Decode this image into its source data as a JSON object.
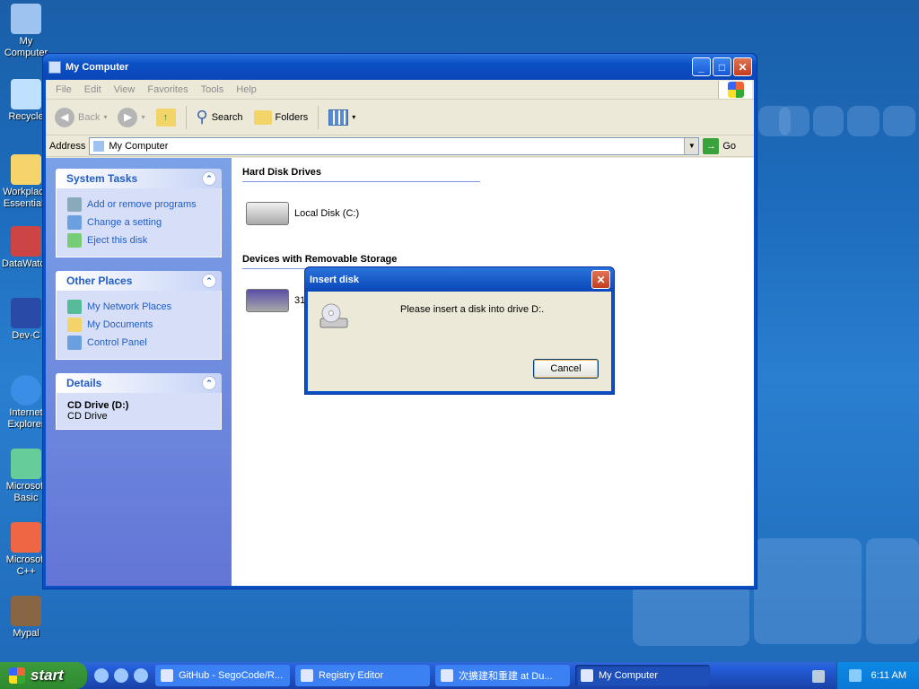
{
  "desktop": {
    "icons": [
      {
        "label": "My Computer"
      },
      {
        "label": "Recycle"
      },
      {
        "label": "Workplace Essentials"
      },
      {
        "label": "DataWatch"
      },
      {
        "label": "Dev-C"
      },
      {
        "label": "Internet Explorer"
      },
      {
        "label": "Microsoft Basic"
      },
      {
        "label": "Microsoft C++"
      },
      {
        "label": "Mypal"
      }
    ]
  },
  "window": {
    "title": "My Computer",
    "menu": [
      "File",
      "Edit",
      "View",
      "Favorites",
      "Tools",
      "Help"
    ],
    "toolbar": {
      "back": "Back",
      "search": "Search",
      "folders": "Folders"
    },
    "address": {
      "label": "Address",
      "value": "My Computer",
      "go": "Go"
    },
    "tasks": {
      "system_title": "System Tasks",
      "system_items": [
        "Add or remove programs",
        "Change a setting",
        "Eject this disk"
      ],
      "other_title": "Other Places",
      "other_items": [
        "My Network Places",
        "My Documents",
        "Control Panel"
      ],
      "details_title": "Details",
      "details_name": "CD Drive (D:)",
      "details_type": "CD Drive"
    },
    "content": {
      "hdd_heading": "Hard Disk Drives",
      "hdd_item": "Local Disk (C:)",
      "removable_heading": "Devices with Removable Storage",
      "removable_item_partial": "31"
    }
  },
  "dialog": {
    "title": "Insert disk",
    "message": "Please insert a disk into drive D:.",
    "cancel": "Cancel"
  },
  "taskbar": {
    "start": "start",
    "tasks": [
      "GitHub - SegoCode/R...",
      "Registry Editor",
      "次擴建和重建 at Du...",
      "My Computer"
    ],
    "clock": "6:11 AM"
  }
}
